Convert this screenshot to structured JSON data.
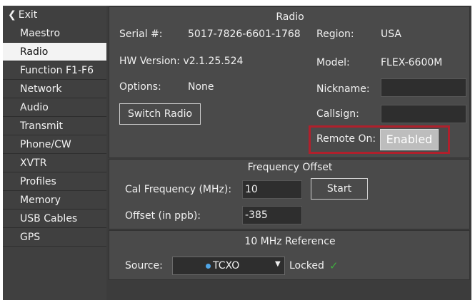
{
  "sidebar": {
    "exit_label": "Exit",
    "items": [
      "Maestro",
      "Radio",
      "Function F1-F6",
      "Network",
      "Audio",
      "Transmit",
      "Phone/CW",
      "XVTR",
      "Profiles",
      "Memory",
      "USB Cables",
      "GPS"
    ],
    "active": "Radio"
  },
  "radio": {
    "title": "Radio",
    "serial_label": "Serial #:",
    "serial_value": "5017-7826-6601-1768",
    "region_label": "Region:",
    "region_value": "USA",
    "hw_version": "HW Version: v2.1.25.524",
    "model_label": "Model:",
    "model_value": "FLEX-6600M",
    "options_label": "Options:",
    "options_value": "None",
    "nickname_label": "Nickname:",
    "nickname_value": "",
    "callsign_label": "Callsign:",
    "callsign_value": "",
    "switch_radio_label": "Switch Radio",
    "remote_on_label": "Remote On:",
    "remote_on_button": "Enabled"
  },
  "frequency_offset": {
    "title": "Frequency Offset",
    "cal_label": "Cal Frequency (MHz):",
    "cal_value": "10",
    "start_label": "Start",
    "offset_label": "Offset (in ppb):",
    "offset_value": "-385"
  },
  "reference": {
    "title": "10 MHz Reference",
    "source_label": "Source:",
    "source_value": "TCXO",
    "locked_label": "Locked",
    "check_icon": "check-icon"
  },
  "colors": {
    "highlight_border": "#b0202c",
    "check": "#3fae3f",
    "source_dot": "#4fa6e8"
  }
}
